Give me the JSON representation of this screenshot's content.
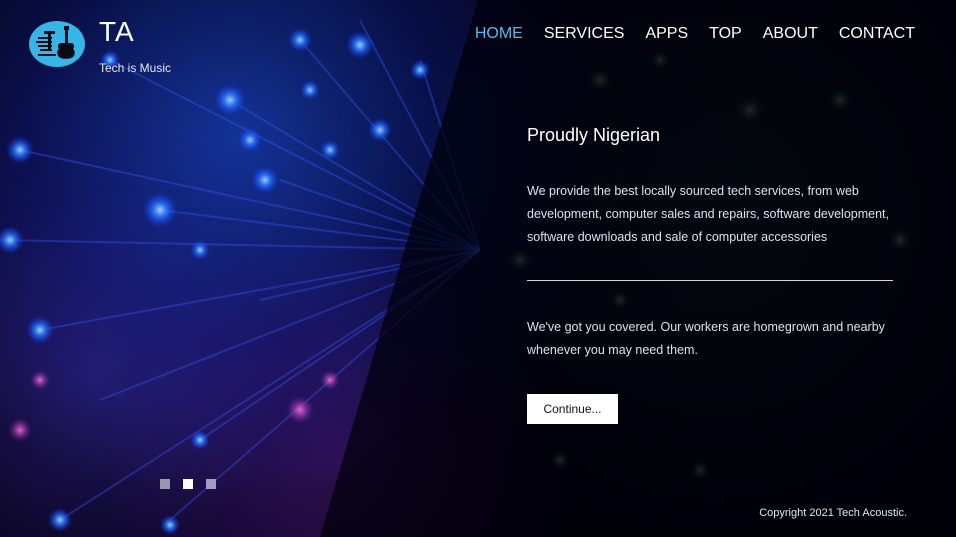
{
  "brand": {
    "title": "TA",
    "tagline": "Tech is Music",
    "logo_icon": "guitar-icon",
    "logo_color": "#36b5e6"
  },
  "nav": {
    "items": [
      {
        "label": "HOME",
        "active": true
      },
      {
        "label": "SERVICES",
        "active": false
      },
      {
        "label": "APPS",
        "active": false
      },
      {
        "label": "TOP",
        "active": false
      },
      {
        "label": "ABOUT",
        "active": false
      },
      {
        "label": "CONTACT",
        "active": false
      }
    ],
    "active_color": "#5fb8e6"
  },
  "hero": {
    "heading": "Proudly Nigerian",
    "paragraph1": "We provide the best locally sourced tech services, from web development, computer sales and repairs, software development, software downloads and sale of computer accessories",
    "paragraph2": "We've got you covered. Our workers are homegrown and nearby whenever you may need them.",
    "button_label": "Continue..."
  },
  "slider": {
    "dots": 3,
    "active_index": 1
  },
  "footer": {
    "copyright": "Copyright 2021 Tech Acoustic."
  }
}
